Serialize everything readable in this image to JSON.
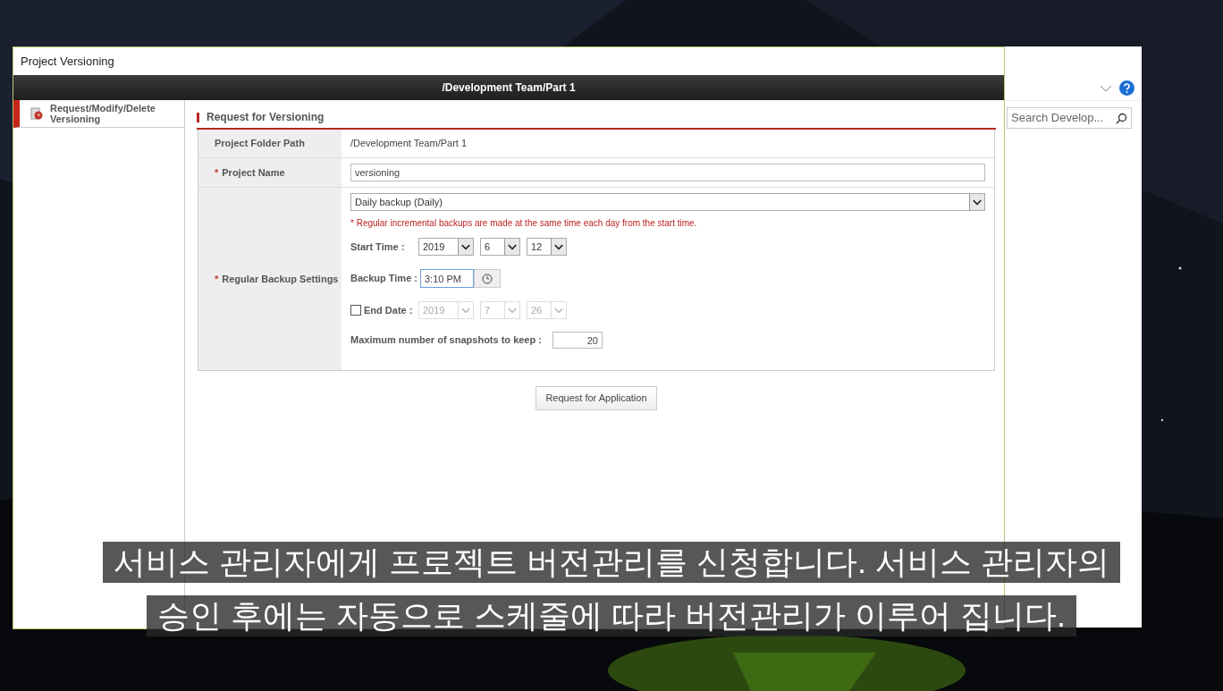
{
  "dialog": {
    "title": "Project Versioning",
    "header": "/Development Team/Part 1",
    "sidebar": {
      "items": [
        {
          "label": "Request/Modify/Delete Versioning",
          "selected": true
        }
      ]
    },
    "section_title": "Request for Versioning",
    "folder_path": {
      "label": "Project Folder Path",
      "value": "/Development Team/Part 1"
    },
    "project_name": {
      "mark": "*",
      "label": "Project Name",
      "value": "versioning"
    },
    "backup": {
      "mark": "*",
      "label": "Regular Backup Settings",
      "schedule": "Daily backup (Daily)",
      "note": "* Regular incremental backups are made at the same time each day from the start time.",
      "start_label": "Start Time :",
      "start": [
        "2019",
        "6",
        "12"
      ],
      "backup_time_label": "Backup Time :",
      "backup_time": "3:10 PM",
      "end_date": {
        "label": "End Date :",
        "checked": false,
        "values": [
          "2019",
          "7",
          "26"
        ]
      },
      "snapshots_label": "Maximum number of snapshots to keep :",
      "snapshots": "20"
    },
    "submit": "Request for Application"
  },
  "explorer": {
    "search": {
      "placeholder": "Search Develop..."
    }
  },
  "subtitles": [
    "서비스 관리자에게 프로젝트 버전관리를 신청합니다. 서비스 관리자의",
    "승인 후에는 자동으로 스케줄에 따라 버전관리가 이루어 집니다."
  ]
}
